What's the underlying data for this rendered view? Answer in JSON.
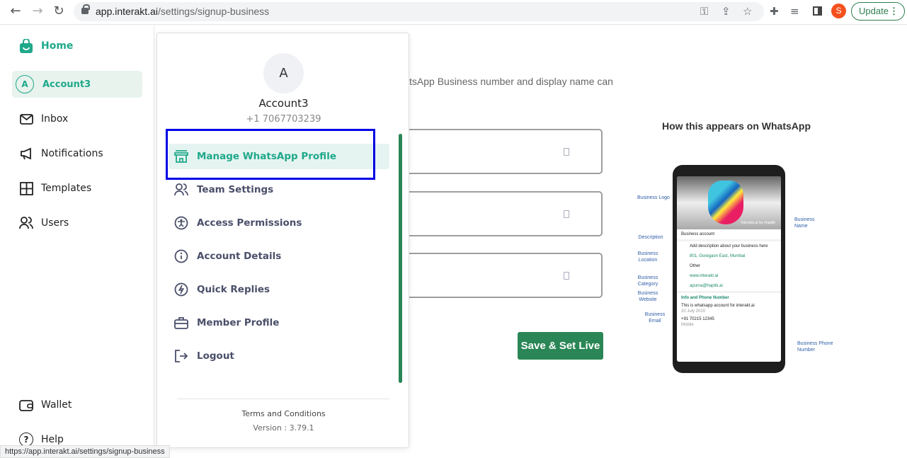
{
  "browser": {
    "url_domain": "app.interakt.ai",
    "url_path": "/settings/signup-business",
    "profile_initial": "S",
    "update_label": "Update",
    "icons": [
      "back-icon",
      "forward-icon",
      "reload-icon",
      "lock-icon",
      "key-icon",
      "share-icon",
      "star-icon",
      "extensions-icon",
      "media-icon",
      "sidepanel-icon",
      "kebab-icon"
    ]
  },
  "sidebar": {
    "items": [
      {
        "label": "Home",
        "icon": "bag-icon"
      },
      {
        "label": "Account3",
        "initial": "A"
      },
      {
        "label": "Inbox",
        "icon": "mail-icon"
      },
      {
        "label": "Notifications",
        "icon": "megaphone-icon"
      },
      {
        "label": "Templates",
        "icon": "grid-icon"
      },
      {
        "label": "Users",
        "icon": "users-icon"
      },
      {
        "label": "Wallet",
        "icon": "wallet-icon"
      },
      {
        "label": "Help",
        "icon": "help-icon"
      }
    ],
    "accent": "#1fa88a"
  },
  "main": {
    "subtitle_fragment": "tsApp Business number and display name can",
    "save_label": "Save & Set Live",
    "preview_title": "How this appears on WhatsApp"
  },
  "preview": {
    "business_name": "Interakt.ai by Haptik",
    "description": "Business account",
    "location_placeholder": "Add description about your business here",
    "address": "801, Goregaon East, Mumbai",
    "category": "Other",
    "website": "www.interakt.ai",
    "email": "apurva@haptik.ai",
    "info_heading": "Info and Phone Number",
    "info_text": "This is whatsapp account for interakt.ai",
    "info_date": "20 July 2020",
    "phone": "+91 70215 12345",
    "phone_type": "Mobile",
    "labels": {
      "logo": "Business Logo",
      "name": "Business Name",
      "description": "Description",
      "location": "Business Location",
      "category": "Business Category",
      "website": "Business Website",
      "email": "Business Email",
      "phone": "Business Phone Number"
    }
  },
  "account_menu": {
    "initial": "A",
    "name": "Account3",
    "phone": "+1 7067703239",
    "items": [
      {
        "label": "Manage WhatsApp Profile",
        "icon": "store-icon",
        "active": true
      },
      {
        "label": "Team Settings",
        "icon": "users-icon"
      },
      {
        "label": "Access Permissions",
        "icon": "accessibility-icon"
      },
      {
        "label": "Account Details",
        "icon": "info-icon"
      },
      {
        "label": "Quick Replies",
        "icon": "lightning-icon"
      },
      {
        "label": "Member Profile",
        "icon": "briefcase-icon"
      },
      {
        "label": "Logout",
        "icon": "logout-icon"
      }
    ],
    "terms": "Terms and Conditions",
    "version": "Version : 3.79.1"
  },
  "status_url": "https://app.interakt.ai/settings/signup-business",
  "colors": {
    "accent": "#1fa88a",
    "button": "#2a8656",
    "highlight": "#0000e6"
  }
}
